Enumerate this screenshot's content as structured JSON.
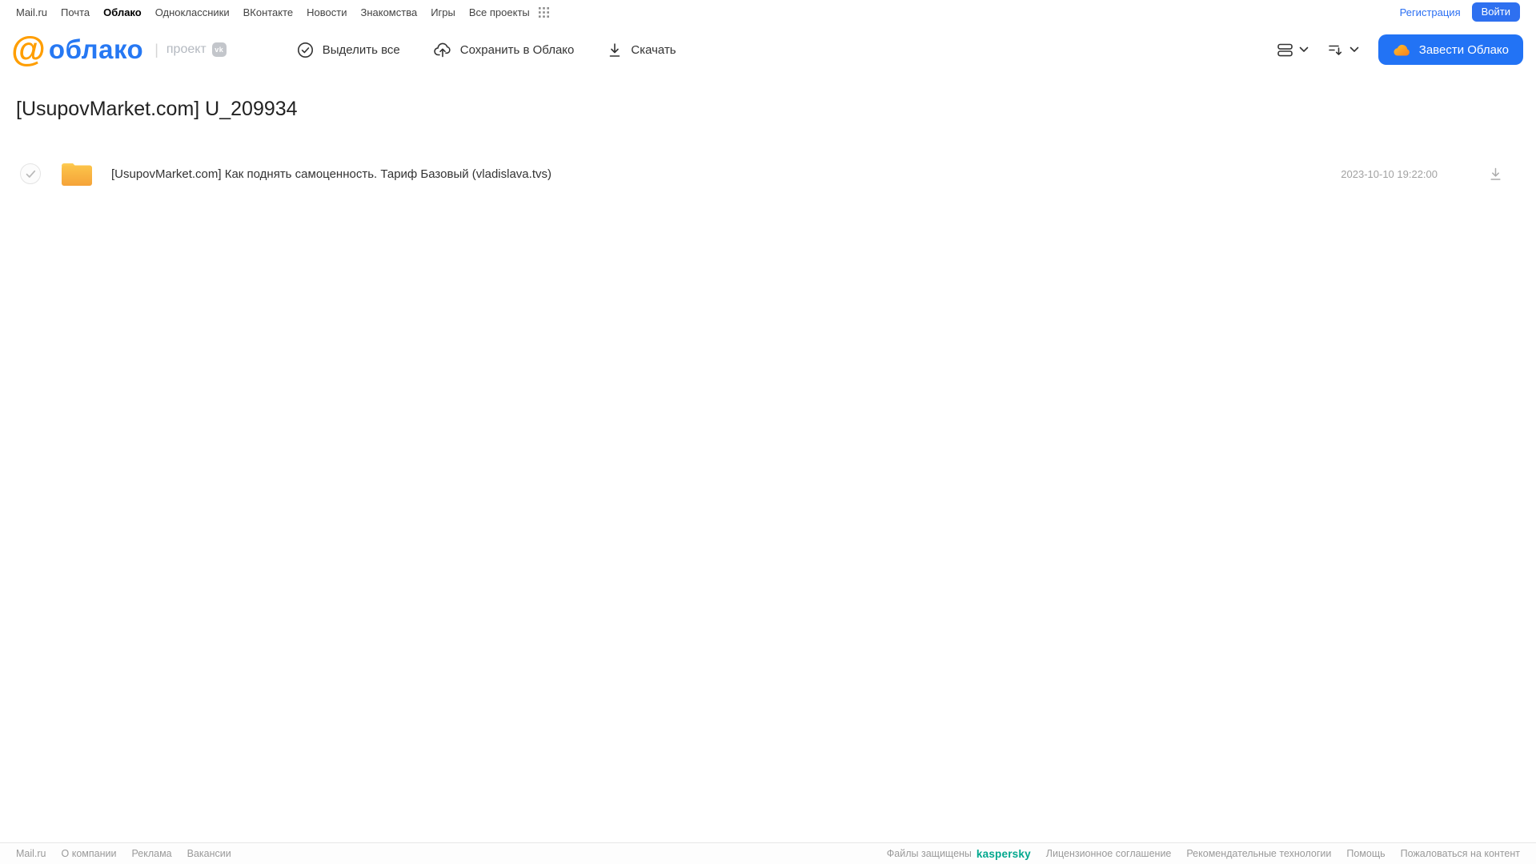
{
  "top_nav": {
    "links": [
      "Mail.ru",
      "Почта",
      "Облако",
      "Одноклассники",
      "ВКонтакте",
      "Новости",
      "Знакомства",
      "Игры",
      "Все проекты"
    ],
    "active_link": "Облако",
    "registration": "Регистрация",
    "login": "Войти"
  },
  "header": {
    "logo_at": "@",
    "logo_text": "облако",
    "project_label": "проект",
    "vk_badge": "vk",
    "toolbar": [
      {
        "label": "Выделить все",
        "icon": "check-circle-icon"
      },
      {
        "label": "Сохранить в Облако",
        "icon": "cloud-upload-icon"
      },
      {
        "label": "Скачать",
        "icon": "download-icon"
      }
    ],
    "view_control_icon": "view-mode-icon",
    "sort_control_icon": "sort-icon",
    "create_cloud_button": "Завести Облако"
  },
  "main": {
    "title": "[UsupovMarket.com] U_209934",
    "files": [
      {
        "type": "folder",
        "name": "[UsupovMarket.com] Как поднять самоценность. Тариф Базовый (vladislava.tvs)",
        "date": "2023-10-10 19:22:00"
      }
    ]
  },
  "footer": {
    "left_links": [
      "Mail.ru",
      "О компании",
      "Реклама",
      "Вакансии"
    ],
    "protected_prefix": "Файлы защищены",
    "kaspersky": "kaspersky",
    "right_links": [
      "Лицензионное соглашение",
      "Рекомендательные технологии",
      "Помощь",
      "Пожаловаться на контент"
    ]
  },
  "colors": {
    "brand_blue": "#2273f5",
    "logo_blue": "#2678f3",
    "logo_orange": "#ff9e00",
    "folder_yellow": "#f8b13f",
    "kaspersky_green": "#00a88e",
    "text_dark": "#333333",
    "text_gray": "#9a9a9a"
  }
}
